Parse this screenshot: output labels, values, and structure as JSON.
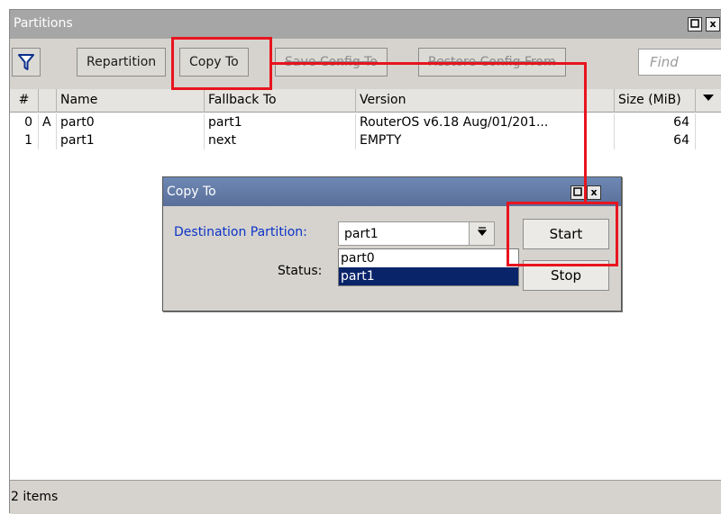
{
  "window": {
    "title": "Partitions",
    "restore_icon": "restore-icon",
    "close_label": "x"
  },
  "toolbar": {
    "filter_icon": "filter-icon",
    "repartition_label": "Repartition",
    "copy_to_label": "Copy To",
    "save_config_label": "Save Config To",
    "restore_config_label": "Restore Config From",
    "find_placeholder": "Find"
  },
  "table": {
    "columns": [
      "#",
      "",
      "Name",
      "Fallback To",
      "Version",
      "Size (MiB)"
    ],
    "menu_icon": "column-menu-icon",
    "rows": [
      {
        "num": "0",
        "flag": "A",
        "name": "part0",
        "fallback": "part1",
        "version": "RouterOS v6.18 Aug/01/201...",
        "size": "64"
      },
      {
        "num": "1",
        "flag": "",
        "name": "part1",
        "fallback": "next",
        "version": "EMPTY",
        "size": "64"
      }
    ]
  },
  "status_bar": {
    "items_text": "2 items"
  },
  "dialog": {
    "title": "Copy To",
    "dest_label": "Destination Partition:",
    "dest_value": "part1",
    "status_label": "Status:",
    "options": [
      "part0",
      "part1"
    ],
    "selected_option": "part1",
    "start_label": "Start",
    "stop_label": "Stop"
  },
  "colors": {
    "highlight": "#e8141e",
    "dialog_title": "#5f77a6",
    "selection": "#0a246a",
    "label_blue": "#0a32c8"
  }
}
